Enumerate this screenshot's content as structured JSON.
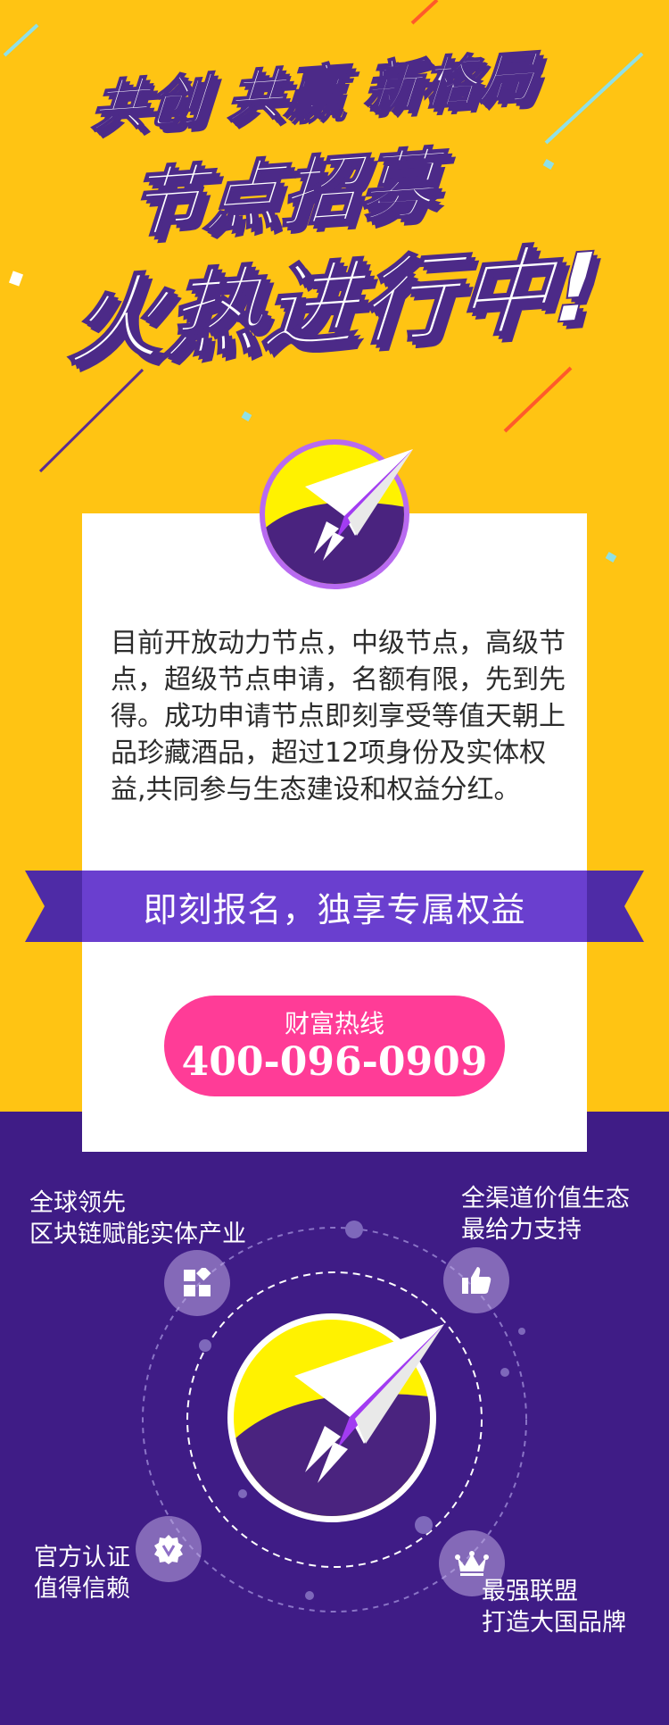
{
  "headline": {
    "line1": "共创 共赢 新格局",
    "line2": "节点招募",
    "line3": "火热进行中!"
  },
  "intro_text": "目前开放动力节点，中级节点，高级节点，超级节点申请，名额有限，先到先得。成功申请节点即刻享受等值天朝上品珍藏酒品，超过12项身份及实体权益,共同参与生态建设和权益分红。",
  "ribbon_text": "即刻报名，独享专属权益",
  "hotline": {
    "label": "财富热线",
    "number": "400-096-0909"
  },
  "features": {
    "top_left": {
      "line1": "全球领先",
      "line2": "区块链赋能实体产业",
      "icon": "blocks-icon"
    },
    "top_right": {
      "line1": "全渠道价值生态",
      "line2": "最给力支持",
      "icon": "thumbs-up-icon"
    },
    "bottom_left": {
      "line1": "官方认证",
      "line2": "值得信赖",
      "icon": "verified-badge-icon"
    },
    "bottom_right": {
      "line1": "最强联盟",
      "line2": "打造大国品牌",
      "icon": "crown-icon"
    }
  },
  "colors": {
    "top_background": "#ffc413",
    "bottom_background": "#3f1c86",
    "ribbon": "#6a3fcf",
    "hotline_button": "#ff3c97",
    "title_shadow": "#4c2a88"
  }
}
